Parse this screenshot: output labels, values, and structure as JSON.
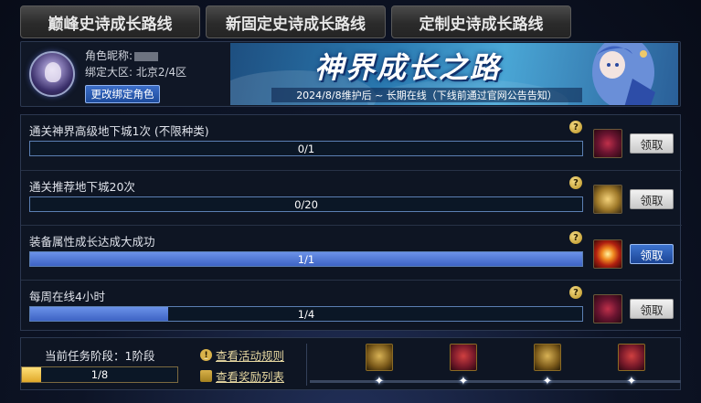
{
  "tabs": [
    {
      "label": "巅峰史诗成长路线",
      "active": true
    },
    {
      "label": "新固定史诗成长路线",
      "active": false
    },
    {
      "label": "定制史诗成长路线",
      "active": false
    }
  ],
  "profile": {
    "nickname_label": "角色昵称:",
    "server_label": "绑定大区: 北京2/4区",
    "rebind_button": "更改绑定角色"
  },
  "banner": {
    "title": "神界成长之路",
    "subtitle": "2024/8/8维护后 ~ 长期在线（下线前通过官网公告告知）"
  },
  "quests": [
    {
      "title": "通关神界高级地下城1次 (不限种类)",
      "progress_text": "0/1",
      "progress": 0,
      "claim_label": "领取",
      "claimable": false,
      "reward_icon": "red"
    },
    {
      "title": "通关推荐地下城20次",
      "progress_text": "0/20",
      "progress": 0,
      "claim_label": "领取",
      "claimable": false,
      "reward_icon": "gold"
    },
    {
      "title": "装备属性成长达成大成功",
      "progress_text": "1/1",
      "progress": 1,
      "claim_label": "领取",
      "claimable": true,
      "reward_icon": "fire"
    },
    {
      "title": "每周在线4小时",
      "progress_text": "1/4",
      "progress": 0.25,
      "claim_label": "领取",
      "claimable": false,
      "reward_icon": "red"
    }
  ],
  "footer": {
    "stage_label": "当前任务阶段：1阶段",
    "stage_progress_text": "1/8",
    "stage_progress": 0.125,
    "rules_link": "查看活动规则",
    "rewards_link": "查看奖励列表",
    "rewards": [
      "gold",
      "red",
      "gold",
      "red"
    ]
  },
  "colors": {
    "active_tab": "#b89040",
    "progress_fill": "#4f76d6",
    "stage_fill": "#f2c24a",
    "claim_ready": "#2a5cb8"
  }
}
